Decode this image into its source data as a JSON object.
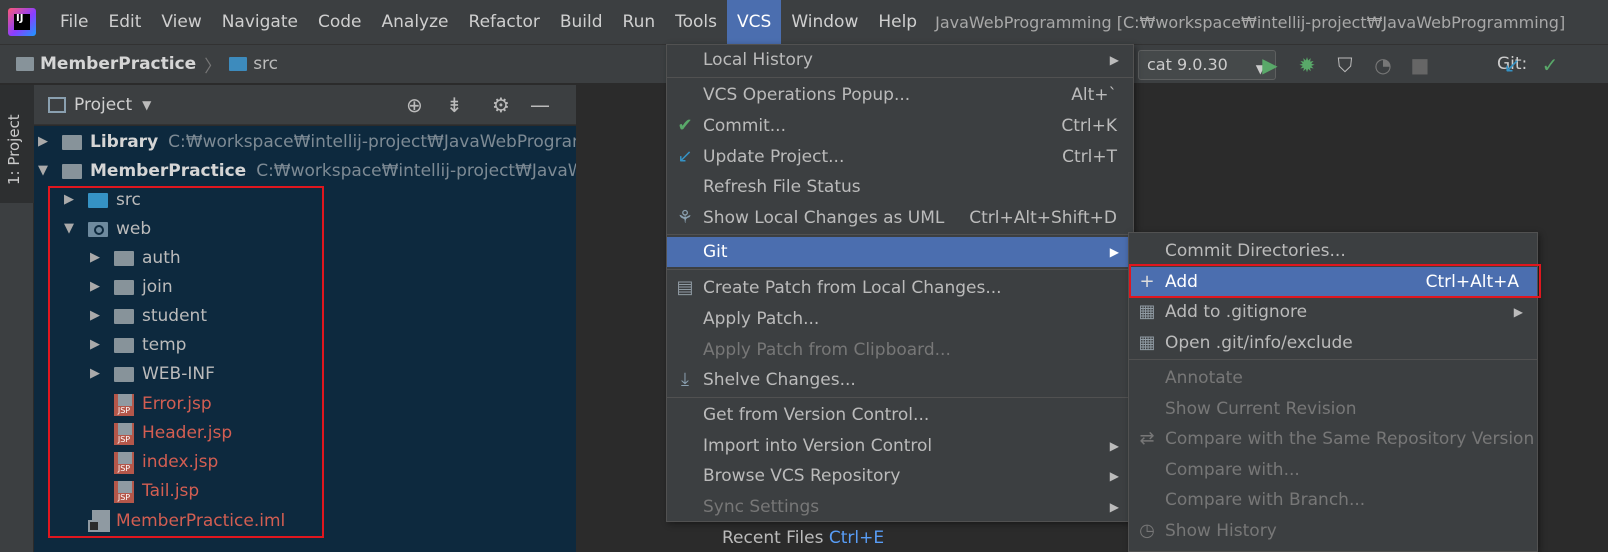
{
  "menubar": {
    "items": [
      "File",
      "Edit",
      "View",
      "Navigate",
      "Code",
      "Analyze",
      "Refactor",
      "Build",
      "Run",
      "Tools",
      "VCS",
      "Window",
      "Help"
    ],
    "active": "VCS",
    "window_title": "JavaWebProgramming [C:₩workspace₩intellij-project₩JavaWebProgramming]"
  },
  "toolbar": {
    "breadcrumb": [
      "MemberPractice",
      "src"
    ],
    "run_config": "cat 9.0.30",
    "git_label": "Git:",
    "icons": [
      "run-icon",
      "debug-icon",
      "coverage-icon",
      "profile-icon",
      "stop-icon",
      "git-update-icon",
      "git-commit-icon"
    ]
  },
  "toolstrip": {
    "tab_label": "1: Project"
  },
  "project_panel": {
    "title": "Project",
    "icons": [
      "locate-icon",
      "collapse-icon",
      "gear-icon",
      "hide-icon"
    ],
    "tree": [
      {
        "label": "Library",
        "path": "C:₩workspace₩intellij-project₩JavaWebProgrammi",
        "bold": true
      },
      {
        "label": "MemberPractice",
        "path": "C:₩workspace₩intellij-project₩JavaWebP",
        "bold": true
      },
      {
        "label": "src"
      },
      {
        "label": "web"
      },
      {
        "label": "auth"
      },
      {
        "label": "join"
      },
      {
        "label": "student"
      },
      {
        "label": "temp"
      },
      {
        "label": "WEB-INF"
      },
      {
        "label": "Error.jsp"
      },
      {
        "label": "Header.jsp"
      },
      {
        "label": "index.jsp"
      },
      {
        "label": "Tail.jsp"
      },
      {
        "label": "MemberPractice.iml"
      }
    ]
  },
  "editor": {
    "recent_prefix": "Recent Files",
    "recent_shortcut": "Ctrl+E"
  },
  "vcs_menu": {
    "items": [
      {
        "label": "Local History",
        "submenu": true
      },
      {
        "label": "VCS Operations Popup...",
        "shortcut": "Alt+`"
      },
      {
        "label": "Commit...",
        "shortcut": "Ctrl+K",
        "icon": "check-icon"
      },
      {
        "label": "Update Project...",
        "shortcut": "Ctrl+T",
        "icon": "update-icon"
      },
      {
        "label": "Refresh File Status"
      },
      {
        "label": "Show Local Changes as UML",
        "shortcut": "Ctrl+Alt+Shift+D",
        "icon": "uml-icon"
      },
      {
        "label": "Git",
        "submenu": true
      },
      {
        "label": "Create Patch from Local Changes...",
        "icon": "patch-icon"
      },
      {
        "label": "Apply Patch..."
      },
      {
        "label": "Apply Patch from Clipboard..."
      },
      {
        "label": "Shelve Changes...",
        "icon": "shelve-icon"
      },
      {
        "label": "Get from Version Control..."
      },
      {
        "label": "Import into Version Control",
        "submenu": true
      },
      {
        "label": "Browse VCS Repository",
        "submenu": true
      },
      {
        "label": "Sync Settings",
        "submenu": true
      }
    ]
  },
  "git_menu": {
    "items": [
      {
        "label": "Commit Directories..."
      },
      {
        "label": "Add",
        "shortcut": "Ctrl+Alt+A",
        "icon": "plus-icon"
      },
      {
        "label": "Add to .gitignore",
        "submenu": true,
        "icon": "gitignore-icon"
      },
      {
        "label": "Open .git/info/exclude",
        "icon": "exclude-icon"
      },
      {
        "label": "Annotate"
      },
      {
        "label": "Show Current Revision"
      },
      {
        "label": "Compare with the Same Repository Version",
        "icon": "compare-icon"
      },
      {
        "label": "Compare with..."
      },
      {
        "label": "Compare with Branch..."
      },
      {
        "label": "Show History",
        "icon": "history-icon"
      }
    ]
  },
  "colors": {
    "accent": "#4b6eaf",
    "highlight_box": "#e0161e",
    "modified_file": "#d35e52"
  }
}
